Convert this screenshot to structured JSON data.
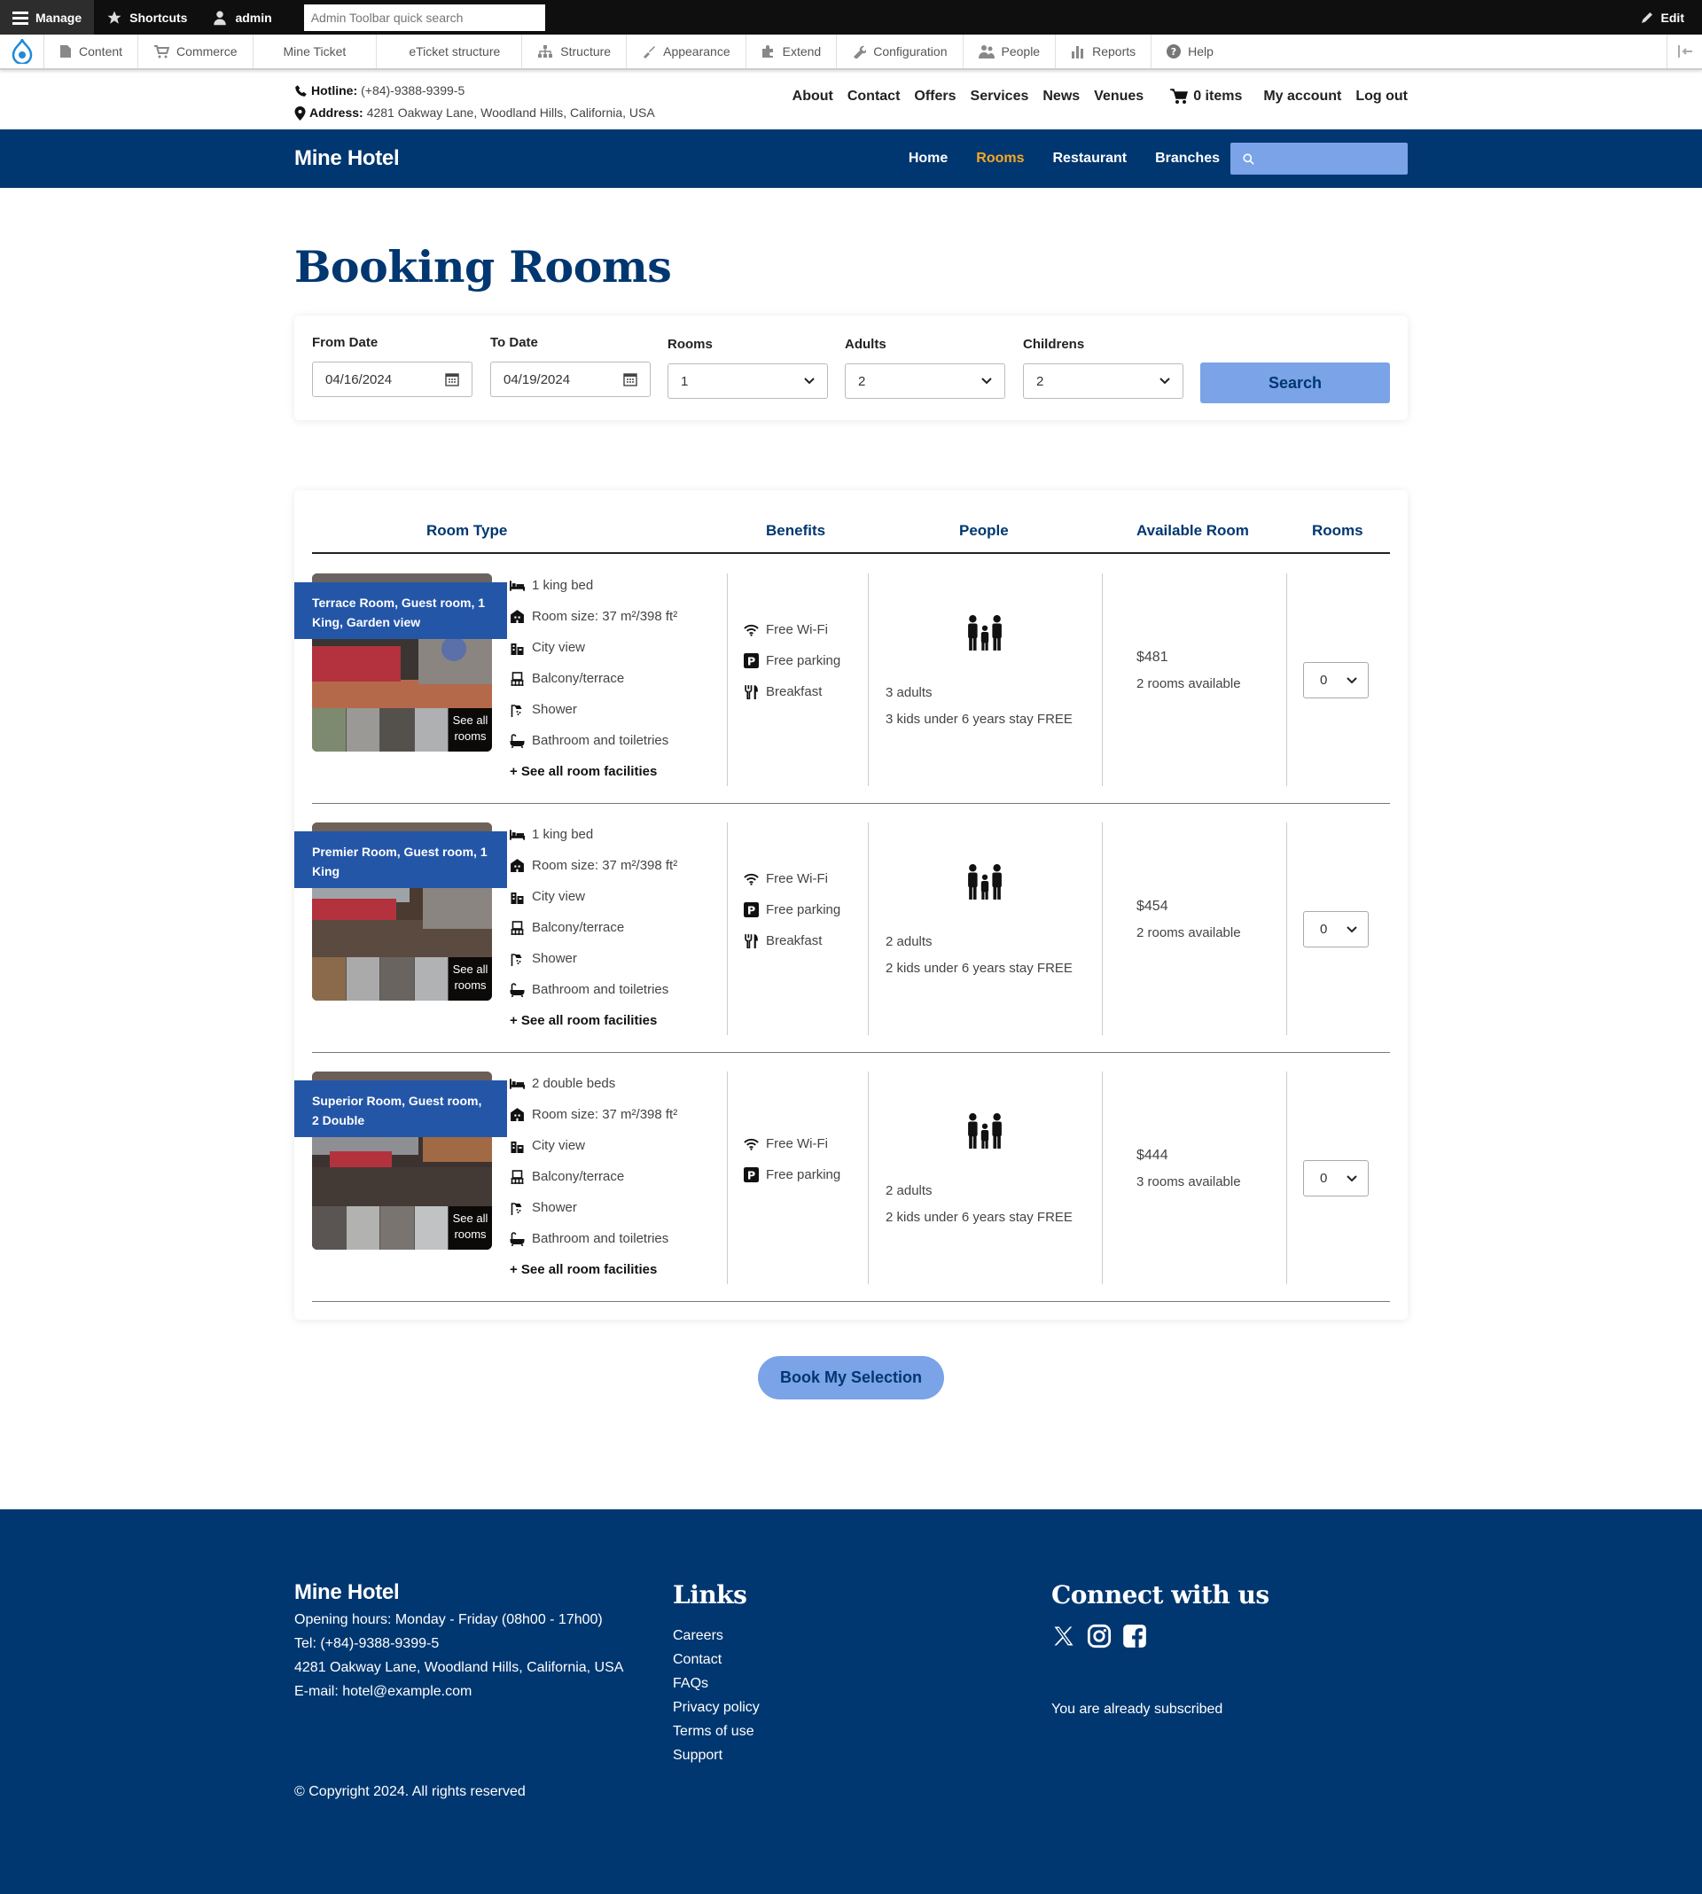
{
  "toolbar": {
    "manage": "Manage",
    "shortcuts": "Shortcuts",
    "user": "admin",
    "search_placeholder": "Admin Toolbar quick search",
    "edit": "Edit"
  },
  "admin_menu": [
    "Content",
    "Commerce",
    "Mine Ticket",
    "eTicket structure",
    "Structure",
    "Appearance",
    "Extend",
    "Configuration",
    "People",
    "Reports",
    "Help"
  ],
  "contact": {
    "hotline_label": "Hotline:",
    "hotline": "(+84)-9388-9399-5",
    "address_label": "Address:",
    "address": "4281 Oakway Lane, Woodland Hills, California, USA"
  },
  "top_nav": [
    "About",
    "Contact",
    "Offers",
    "Services",
    "News",
    "Venues"
  ],
  "cart": "0 items",
  "account": {
    "my_account": "My account",
    "logout": "Log out"
  },
  "site": {
    "name": "Mine Hotel"
  },
  "main_nav": [
    "Home",
    "Rooms",
    "Restaurant",
    "Branches"
  ],
  "page_title": "Booking Rooms",
  "filters": {
    "from_label": "From Date",
    "from_value": "04/16/2024",
    "to_label": "To Date",
    "to_value": "04/19/2024",
    "rooms_label": "Rooms",
    "rooms_value": "1",
    "adults_label": "Adults",
    "adults_value": "2",
    "children_label": "Childrens",
    "children_value": "2",
    "search_button": "Search"
  },
  "table_headers": [
    "Room Type",
    "Benefits",
    "People",
    "Available Room",
    "Rooms"
  ],
  "rooms": [
    {
      "name": "Terrace Room, Guest room, 1 King, Garden view",
      "see_all": "See all rooms",
      "features": [
        "1 king bed",
        "Room size: 37 m²/398 ft²",
        "City view",
        "Balcony/terrace",
        "Shower",
        "Bathroom and toiletries"
      ],
      "see_facilities": "+ See all room facilities",
      "benefits": [
        "Free Wi-Fi",
        "Free parking",
        "Breakfast"
      ],
      "adults": "3 adults",
      "kids": "3 kids under 6 years stay FREE",
      "price": "$481",
      "available": "2 rooms available",
      "qty": "0"
    },
    {
      "name": "Premier Room, Guest room, 1 King",
      "see_all": "See all rooms",
      "features": [
        "1 king bed",
        "Room size: 37 m²/398 ft²",
        "City view",
        "Balcony/terrace",
        "Shower",
        "Bathroom and toiletries"
      ],
      "see_facilities": "+ See all room facilities",
      "benefits": [
        "Free Wi-Fi",
        "Free parking",
        "Breakfast"
      ],
      "adults": "2 adults",
      "kids": "2 kids under 6 years stay FREE",
      "price": "$454",
      "available": "2 rooms available",
      "qty": "0"
    },
    {
      "name": "Superior Room, Guest room, 2 Double",
      "see_all": "See all rooms",
      "features": [
        "2 double beds",
        "Room size: 37 m²/398 ft²",
        "City view",
        "Balcony/terrace",
        "Shower",
        "Bathroom and toiletries"
      ],
      "see_facilities": "+ See all room facilities",
      "benefits": [
        "Free Wi-Fi",
        "Free parking"
      ],
      "adults": "2 adults",
      "kids": "2 kids under 6 years stay FREE",
      "price": "$444",
      "available": "3 rooms available",
      "qty": "0"
    }
  ],
  "book_button": "Book My Selection",
  "footer": {
    "brand": "Mine Hotel",
    "hours": "Opening hours: Monday - Friday (08h00 - 17h00)",
    "tel": "Tel: (+84)-9388-9399-5",
    "address": "4281 Oakway Lane, Woodland Hills, California, USA",
    "email": "E-mail: hotel@example.com",
    "links_title": "Links",
    "links": [
      "Careers",
      "Contact",
      "FAQs",
      "Privacy policy",
      "Terms of use",
      "Support"
    ],
    "connect_title": "Connect with us",
    "subscribed": "You are already subscribed",
    "copyright": "© Copyright 2024. All rights reserved"
  },
  "colors": {
    "navy": "#003770",
    "accent": "#f7a823",
    "button": "#7aa3e8",
    "label_blue": "#2456a8"
  }
}
